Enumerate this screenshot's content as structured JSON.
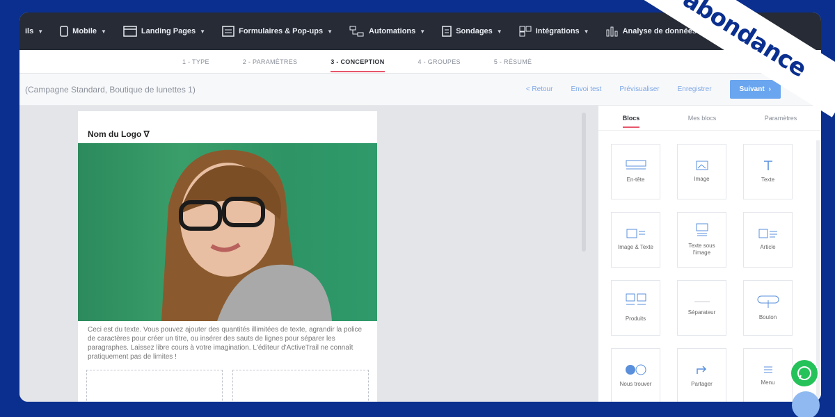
{
  "nav": {
    "items": [
      {
        "label": "ils",
        "icon": "list-icon"
      },
      {
        "label": "Mobile",
        "icon": "mobile-icon"
      },
      {
        "label": "Landing Pages",
        "icon": "page-icon"
      },
      {
        "label": "Formulaires & Pop-ups",
        "icon": "form-icon"
      },
      {
        "label": "Automations",
        "icon": "automation-icon"
      },
      {
        "label": "Sondages",
        "icon": "survey-icon"
      },
      {
        "label": "Intégrations",
        "icon": "integrations-icon"
      },
      {
        "label": "Analyse de données",
        "icon": "chart-icon"
      }
    ]
  },
  "steps": [
    "1 - TYPE",
    "2 - PARAMÈTRES",
    "3 - CONCEPTION",
    "4 - GROUPES",
    "5 - RÉSUMÉ"
  ],
  "toolbar": {
    "campaign": "(Campagne Standard, Boutique de lunettes 1)",
    "back": "< Retour",
    "test": "Envoi test",
    "preview": "Prévisualiser",
    "save": "Enregistrer",
    "next": "Suivant"
  },
  "email": {
    "logo": "Nom du Logo ∇",
    "text": "Ceci est du texte. Vous pouvez ajouter des quantités illimitées de texte, agrandir la police de caractères pour créer un titre, ou insérer des sauts de lignes pour séparer les paragraphes. Laissez libre cours à votre imagination. L'éditeur d'ActiveTrail ne connaît pratiquement pas de limites !"
  },
  "panel": {
    "tabs": [
      "Blocs",
      "Mes blocs",
      "Paramètres"
    ],
    "blocks": [
      {
        "label": "En-tête",
        "icon": "header-icon"
      },
      {
        "label": "Image",
        "icon": "image-icon"
      },
      {
        "label": "Texte",
        "icon": "text-icon"
      },
      {
        "label": "Image & Texte",
        "icon": "image-text-icon"
      },
      {
        "label": "Texte sous l'image",
        "icon": "text-below-image-icon"
      },
      {
        "label": "Article",
        "icon": "article-icon"
      },
      {
        "label": "Produits",
        "icon": "products-icon"
      },
      {
        "label": "Séparateur",
        "icon": "divider-icon"
      },
      {
        "label": "Bouton",
        "icon": "button-icon"
      },
      {
        "label": "Nous trouver",
        "icon": "social-icon"
      },
      {
        "label": "Partager",
        "icon": "share-icon"
      },
      {
        "label": "Menu",
        "icon": "menu-icon"
      }
    ]
  },
  "brand": {
    "name": "abondance",
    "color": "#0a2f8f"
  }
}
